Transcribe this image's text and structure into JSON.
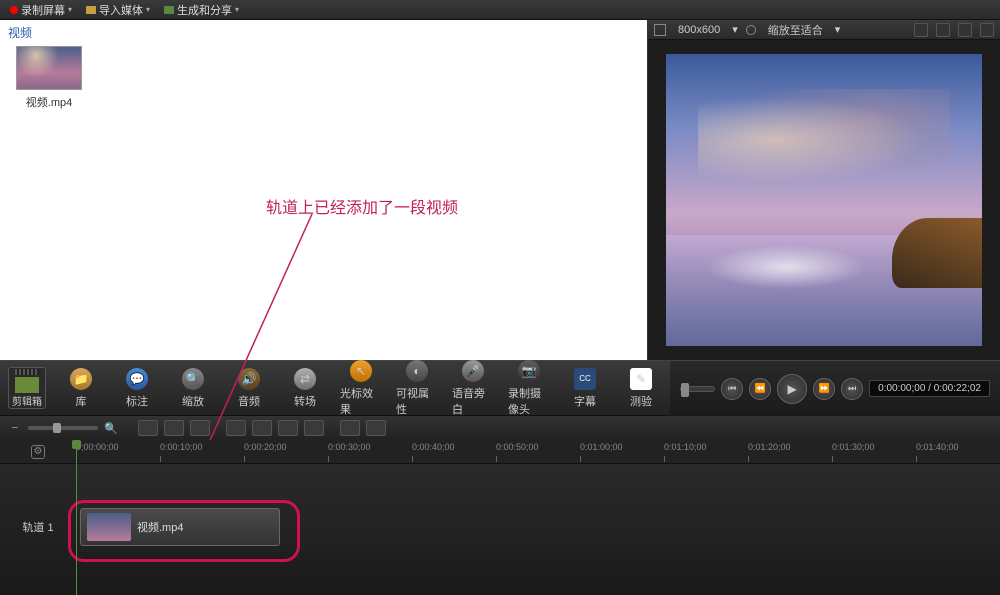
{
  "topbar": {
    "record": "录制屏幕",
    "import": "导入媒体",
    "share": "生成和分享"
  },
  "media_bin": {
    "title": "视频",
    "clip_name": "视频.mp4"
  },
  "annotation": {
    "text": "轨道上已经添加了一段视频"
  },
  "preview": {
    "dimensions": "800x600",
    "fit": "缩放至适合"
  },
  "tools": {
    "clipbox": "剪辑箱",
    "library": "库",
    "callout": "标注",
    "zoom": "缩放",
    "audio": "音频",
    "transition": "转场",
    "cursor": "光标效果",
    "visual": "可视属性",
    "voice": "语音旁白",
    "camera": "录制摄像头",
    "caption": "字幕",
    "test": "测验"
  },
  "playback": {
    "time": "0:00:00;00 / 0:00:22;02"
  },
  "ruler": {
    "ticks": [
      "0;00:00;00",
      "0:00:10;00",
      "0:00:20;00",
      "0:00:30;00",
      "0:00:40;00",
      "0:00:50;00",
      "0:01:00;00",
      "0:01:10;00",
      "0:01:20;00",
      "0:01:30;00",
      "0:01:40;00"
    ]
  },
  "track": {
    "name": "轨道 1",
    "clip_name": "视频.mp4"
  }
}
